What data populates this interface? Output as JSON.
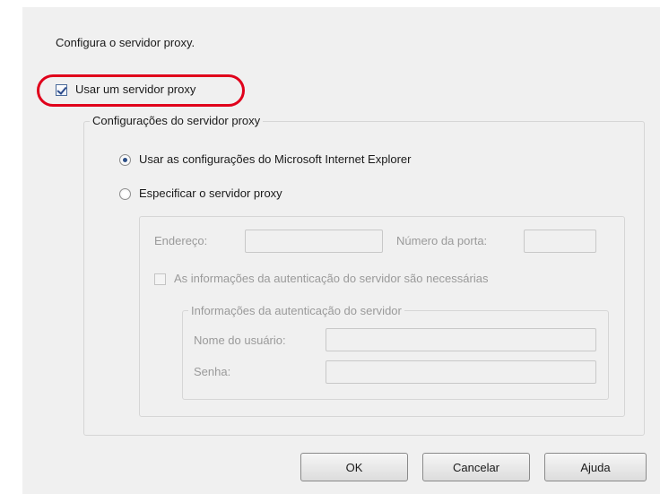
{
  "description": "Configura o servidor proxy.",
  "use_proxy": {
    "label": "Usar um servidor proxy",
    "checked": true
  },
  "proxy_settings": {
    "title": "Configurações do servidor proxy",
    "option_ie": "Usar as configurações do Microsoft Internet Explorer",
    "option_specify": "Especificar o servidor proxy",
    "selected_option": "ie",
    "address_label": "Endereço:",
    "address_value": "",
    "port_label": "Número da porta:",
    "port_value": "",
    "auth_required_label": "As informações da autenticação do servidor são necessárias",
    "auth_group": {
      "title": "Informações da autenticação do servidor",
      "username_label": "Nome do usuário:",
      "username_value": "",
      "password_label": "Senha:",
      "password_value": ""
    }
  },
  "buttons": {
    "ok": "OK",
    "cancel": "Cancelar",
    "help": "Ajuda"
  },
  "colors": {
    "highlight": "#e0001b",
    "dialog_bg": "#f0f0f0",
    "disabled_text": "#9a9a9a"
  }
}
